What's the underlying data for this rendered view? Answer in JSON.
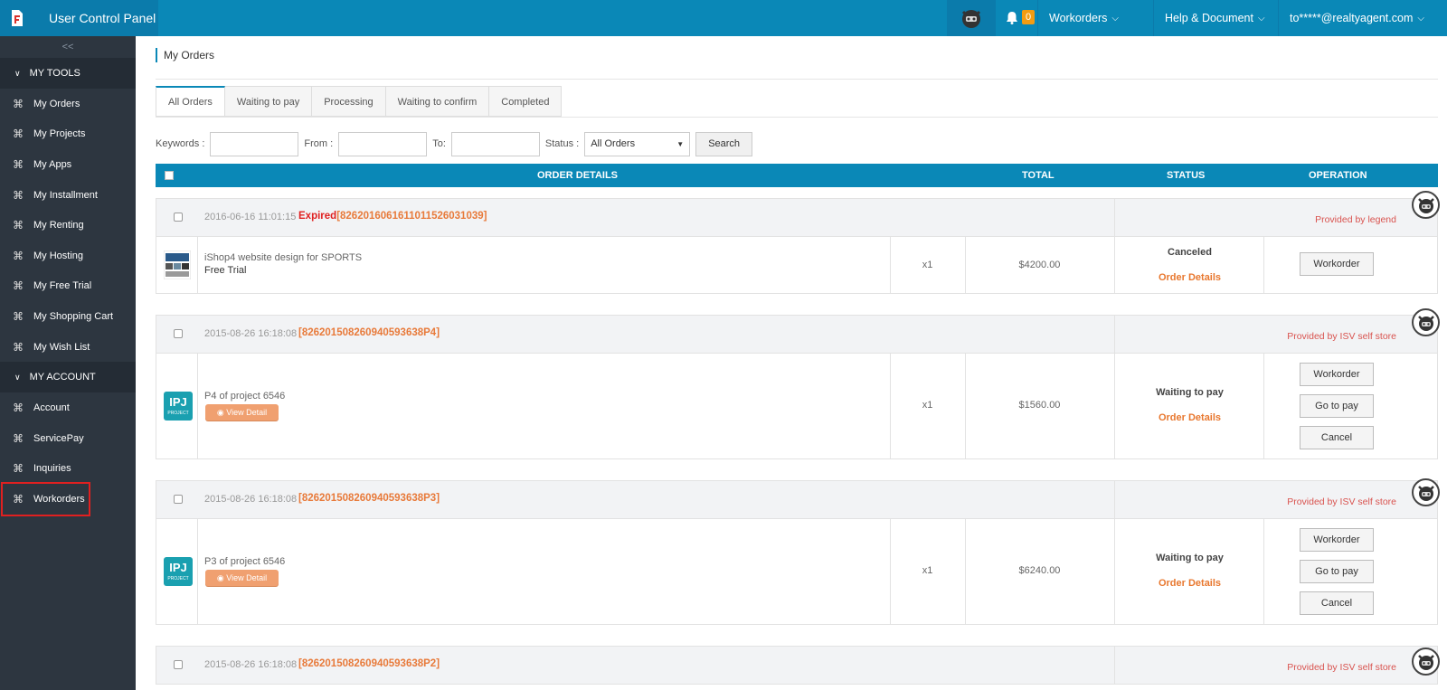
{
  "app": {
    "title": "User Control Panel"
  },
  "header": {
    "notification_count": "0",
    "menus": [
      "Workorders",
      "Help & Document",
      "to*****@realtyagent.com"
    ]
  },
  "sidebar": {
    "collapse_label": "<<",
    "sections": [
      {
        "label": "MY TOOLS",
        "items": [
          "My Orders",
          "My Projects",
          "My Apps",
          "My Installment",
          "My Renting",
          "My Hosting",
          "My Free Trial",
          "My Shopping Cart",
          "My Wish List"
        ]
      },
      {
        "label": "MY ACCOUNT",
        "items": [
          "Account",
          "ServicePay",
          "Inquiries",
          "Workorders"
        ]
      }
    ],
    "active_item": "Workorders"
  },
  "page": {
    "title": "My Orders"
  },
  "tabs": [
    "All Orders",
    "Waiting to pay",
    "Processing",
    "Waiting to confirm",
    "Completed"
  ],
  "filters": {
    "keywords_label": "Keywords :",
    "from_label": "From :",
    "to_label": "To:",
    "status_label": "Status :",
    "status_value": "All Orders",
    "search_label": "Search"
  },
  "table": {
    "headers": [
      "ORDER DETAILS",
      "TOTAL",
      "STATUS",
      "OPERATION"
    ]
  },
  "orders": [
    {
      "date": "2016-06-16 11:01:15",
      "prefix": "Expired",
      "number": "[8262016061611011526031039]",
      "provider": "Provided by legend",
      "product": "iShop4 website design for SPORTS",
      "subtitle": "Free Trial",
      "qty": "x1",
      "total": "$4200.00",
      "status": "Canceled",
      "details_link": "Order Details",
      "buttons": [
        "Workorder"
      ]
    },
    {
      "date": "2015-08-26 16:18:08",
      "prefix": "",
      "number": "[826201508260940593638P4]",
      "provider": "Provided by ISV self store",
      "product": "P4 of project 6546",
      "view_label": "View Detail",
      "qty": "x1",
      "total": "$1560.00",
      "status": "Waiting to pay",
      "details_link": "Order Details",
      "buttons": [
        "Workorder",
        "Go to pay",
        "Cancel"
      ]
    },
    {
      "date": "2015-08-26 16:18:08",
      "prefix": "",
      "number": "[826201508260940593638P3]",
      "provider": "Provided by ISV self store",
      "product": "P3 of project 6546",
      "view_label": "View Detail",
      "qty": "x1",
      "total": "$6240.00",
      "status": "Waiting to pay",
      "details_link": "Order Details",
      "buttons": [
        "Workorder",
        "Go to pay",
        "Cancel"
      ]
    },
    {
      "date": "2015-08-26 16:18:08",
      "prefix": "",
      "number": "[826201508260940593638P2]",
      "provider": "Provided by ISV self store"
    }
  ],
  "project_icon": {
    "main": "IPJ",
    "sub": "PROJECT"
  },
  "colors": {
    "topbar": "#0a88b7",
    "sidebar": "#2d3640",
    "accent_orange": "#e8772e",
    "provider_red": "#d9534f"
  }
}
